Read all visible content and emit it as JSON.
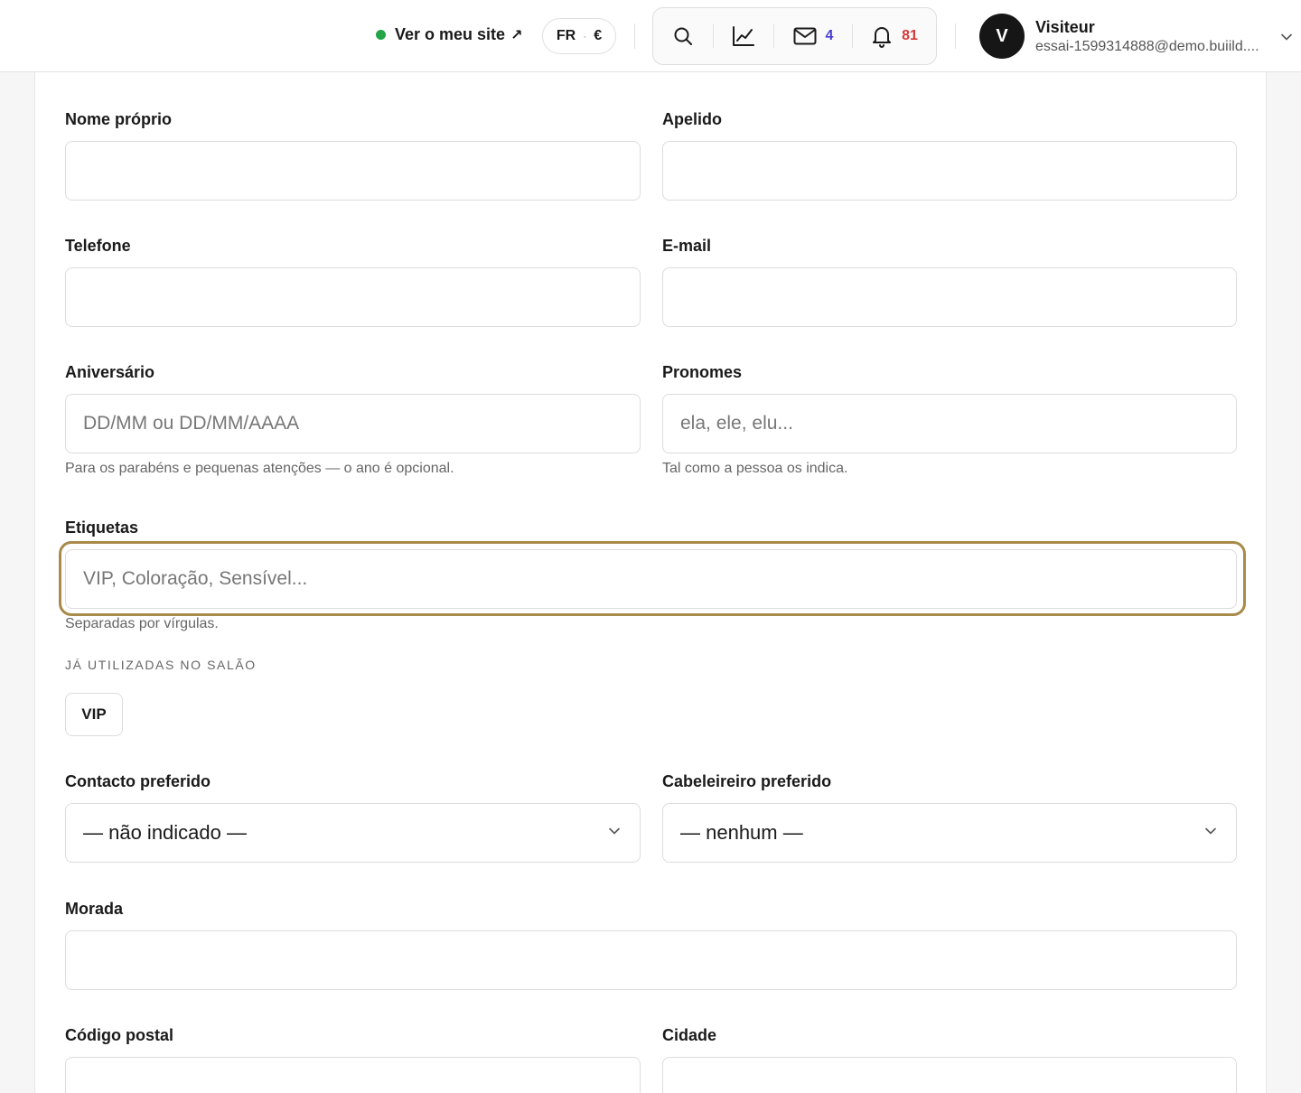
{
  "topbar": {
    "site_link": "Ver o meu site",
    "site_link_arrow": "↗",
    "locale": "FR",
    "locale_separator": "·",
    "currency": "€",
    "messages_count": "4",
    "notifications_count": "81",
    "status_color": "#22a447",
    "user": {
      "initial": "V",
      "name": "Visiteur",
      "email": "essai-1599314888@demo.buiild...."
    }
  },
  "form": {
    "first_name": {
      "label": "Nome próprio",
      "value": ""
    },
    "last_name": {
      "label": "Apelido",
      "value": ""
    },
    "phone": {
      "label": "Telefone",
      "value": ""
    },
    "email": {
      "label": "E-mail",
      "value": ""
    },
    "birthday": {
      "label": "Aniversário",
      "placeholder": "DD/MM ou DD/MM/AAAA",
      "hint": "Para os parabéns e pequenas atenções — o ano é opcional."
    },
    "pronouns": {
      "label": "Pronomes",
      "placeholder": "ela, ele, elu...",
      "hint": "Tal como a pessoa os indica."
    },
    "tags": {
      "label": "Etiquetas",
      "placeholder": "VIP, Coloração, Sensível...",
      "hint": "Separadas por vírgulas.",
      "used_caption": "JÁ UTILIZADAS NO SALÃO",
      "used": [
        "VIP"
      ]
    },
    "preferred_contact": {
      "label": "Contacto preferido",
      "selected": "— não indicado —"
    },
    "preferred_stylist": {
      "label": "Cabeleireiro preferido",
      "selected": "— nenhum —"
    },
    "address": {
      "label": "Morada",
      "value": ""
    },
    "postal_code": {
      "label": "Código postal",
      "value": ""
    },
    "city": {
      "label": "Cidade",
      "value": ""
    }
  },
  "colors": {
    "focus_ring": "#a88a4a",
    "message_badge": "#4a3fd6",
    "notification_badge": "#d63838"
  }
}
